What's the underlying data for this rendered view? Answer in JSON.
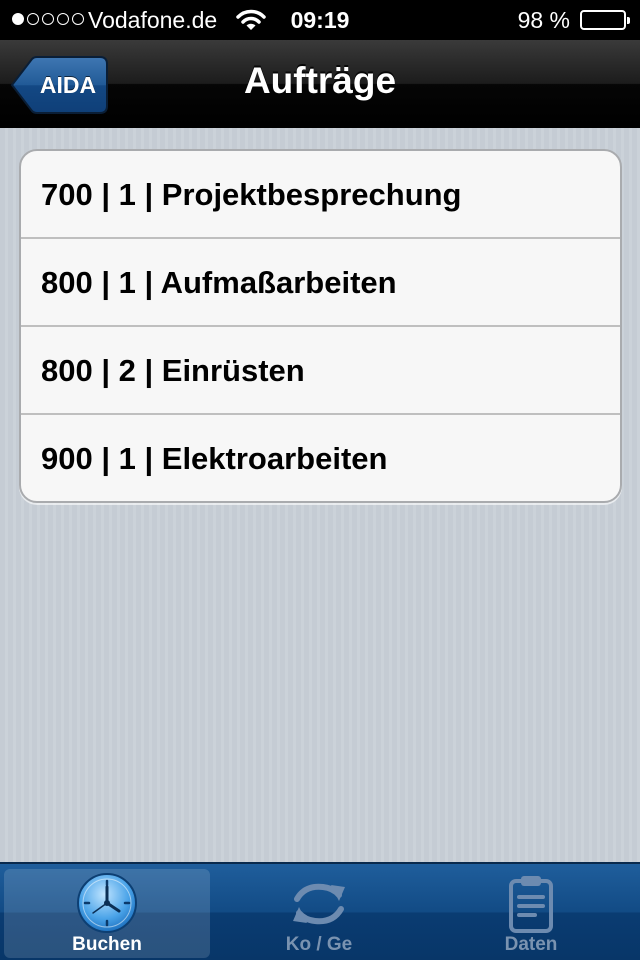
{
  "status_bar": {
    "carrier": "Vodafone.de",
    "time": "09:19",
    "battery": "98 %",
    "battery_level": 0.98,
    "signal_bars": 1,
    "icons": [
      "signal-dots-icon",
      "wifi-icon",
      "battery-icon"
    ]
  },
  "nav": {
    "title": "Aufträge",
    "back_label": "AIDA"
  },
  "orders": [
    {
      "label": "700 | 1 | Projektbesprechung"
    },
    {
      "label": "800 | 1 | Aufmaßarbeiten"
    },
    {
      "label": "800 | 2 | Einrüsten"
    },
    {
      "label": "900 | 1 | Elektroarbeiten"
    }
  ],
  "tabs": [
    {
      "label": "Buchen",
      "icon": "clock-icon",
      "active": true
    },
    {
      "label": "Ko / Ge",
      "icon": "sync-arrows-icon",
      "active": false
    },
    {
      "label": "Daten",
      "icon": "clipboard-icon",
      "active": false
    }
  ],
  "colors": {
    "tab_bar": "#124b85",
    "nav_bar": "#1c1c1c",
    "back_button": "#1b4f8a",
    "list_background": "#f7f7f7"
  }
}
